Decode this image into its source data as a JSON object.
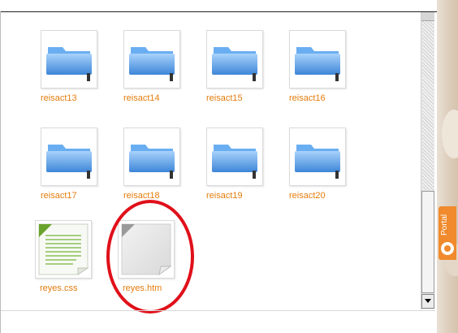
{
  "files": [
    {
      "name": "reisact13",
      "type": "folder"
    },
    {
      "name": "reisact14",
      "type": "folder"
    },
    {
      "name": "reisact15",
      "type": "folder"
    },
    {
      "name": "reisact16",
      "type": "folder"
    },
    {
      "name": "reisact17",
      "type": "folder"
    },
    {
      "name": "reisact18",
      "type": "folder"
    },
    {
      "name": "reisact19",
      "type": "folder"
    },
    {
      "name": "reisact20",
      "type": "folder"
    },
    {
      "name": "reyes.css",
      "type": "css-file"
    },
    {
      "name": "reyes.htm",
      "type": "htm-file"
    }
  ],
  "side_tab": {
    "label": "Portal",
    "icon": "portal-icon"
  },
  "colors": {
    "label": "#e57c0c",
    "folder": "#5b9fe6",
    "css_corner": "#6aa32c",
    "highlight": "#e0101a",
    "tab": "#f08a2c"
  }
}
